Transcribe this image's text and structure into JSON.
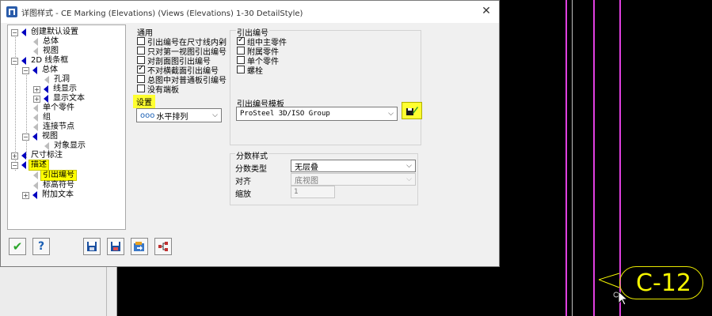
{
  "dialog": {
    "title": "详图样式 - CE Marking (Elevations) (Views (Elevations) 1-30 DetailStyle)",
    "close_glyph": "✕"
  },
  "tree": {
    "items": [
      {
        "label": "创建默认设置"
      },
      {
        "label": "总体"
      },
      {
        "label": "视图"
      },
      {
        "label": "2D 线条框"
      },
      {
        "label": "总体"
      },
      {
        "label": "孔洞"
      },
      {
        "label": "线显示"
      },
      {
        "label": "显示文本"
      },
      {
        "label": "单个零件"
      },
      {
        "label": "组"
      },
      {
        "label": "连接节点"
      },
      {
        "label": "视图"
      },
      {
        "label": "对象显示"
      },
      {
        "label": "尺寸标注"
      },
      {
        "label": "描述"
      },
      {
        "label": "引出编号"
      },
      {
        "label": "标高符号"
      },
      {
        "label": "附加文本"
      }
    ]
  },
  "general": {
    "title": "通用",
    "checks": [
      {
        "label": "引出编号在尺寸线内剁",
        "checked": false
      },
      {
        "label": "只对第一视图引出编号",
        "checked": false
      },
      {
        "label": "对剖面图引出编号",
        "checked": false
      },
      {
        "label": "不对横截面引出编号",
        "checked": true
      },
      {
        "label": "总图中对普通板引编号",
        "checked": false
      },
      {
        "label": "没有端板",
        "checked": false
      }
    ],
    "settings_label": "设置",
    "arrangement_value": "水平排列",
    "arrangement_icon": "ooo"
  },
  "callout": {
    "title": "引出编号",
    "checks": [
      {
        "label": "组中主零件",
        "checked": true
      },
      {
        "label": "附属零件",
        "checked": false
      },
      {
        "label": "单个零件",
        "checked": false
      },
      {
        "label": "螺栓",
        "checked": false
      }
    ],
    "template_label": "引出编号模板",
    "template_value": "ProSteel 3D/ISO Group"
  },
  "fraction": {
    "title": "分数样式",
    "type_label": "分数类型",
    "type_value": "无层叠",
    "align_label": "对齐",
    "align_value": "底视图",
    "scale_label": "缩放",
    "scale_value": "1"
  },
  "canvas": {
    "bubble_text": "C-12",
    "line_color": "#e040e0",
    "accent_yellow": "#f5f500"
  },
  "buttons": {
    "ok": "✔",
    "help": "?"
  }
}
